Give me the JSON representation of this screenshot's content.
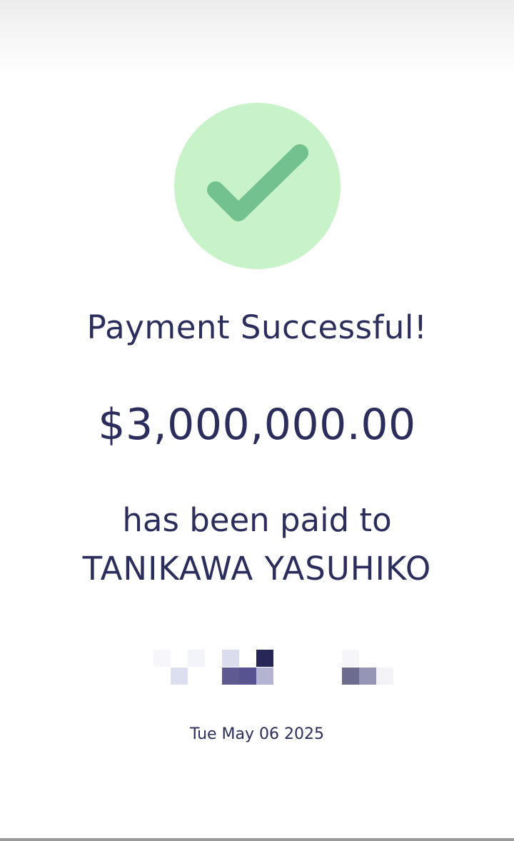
{
  "status": {
    "title": "Payment Successful!",
    "icon": "check-icon",
    "icon_color": "#72c18f",
    "circle_color": "#c8f3c8"
  },
  "payment": {
    "amount": "$3,000,000.00",
    "paid_label": "has been paid to",
    "payee": "TANIKAWA YASUHIKO",
    "reference_redacted": true,
    "date": "Tue May 06 2025"
  },
  "colors": {
    "text": "#2b2e5c",
    "background": "#ffffff"
  }
}
